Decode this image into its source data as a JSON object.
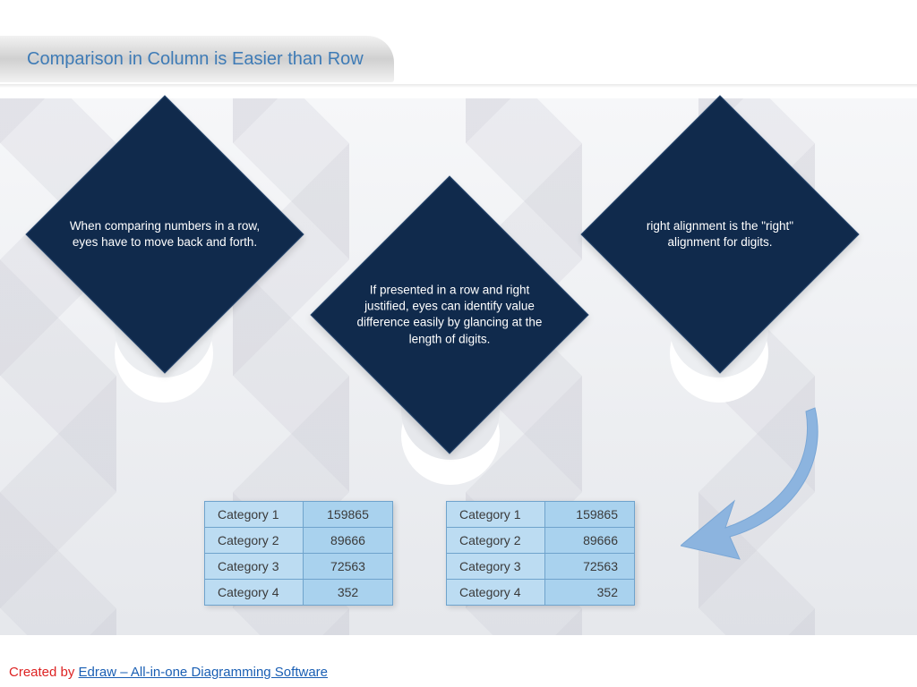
{
  "title": "Comparison in Column is Easier than Row",
  "diamonds": {
    "d1": "When comparing numbers in a row, eyes have to move back and forth.",
    "d2": "If presented in a row and right justified, eyes can identify value difference easily by glancing at the length of digits.",
    "d3": "right alignment is the \"right\" alignment for digits."
  },
  "rows": [
    {
      "k": "Category 1",
      "v": "159865"
    },
    {
      "k": "Category  2",
      "v": "89666"
    },
    {
      "k": "Category  3",
      "v": "72563"
    },
    {
      "k": "Category  4",
      "v": "352"
    }
  ],
  "footer": {
    "created": "Created by ",
    "link": "Edraw – All-in-one Diagramming Software"
  }
}
